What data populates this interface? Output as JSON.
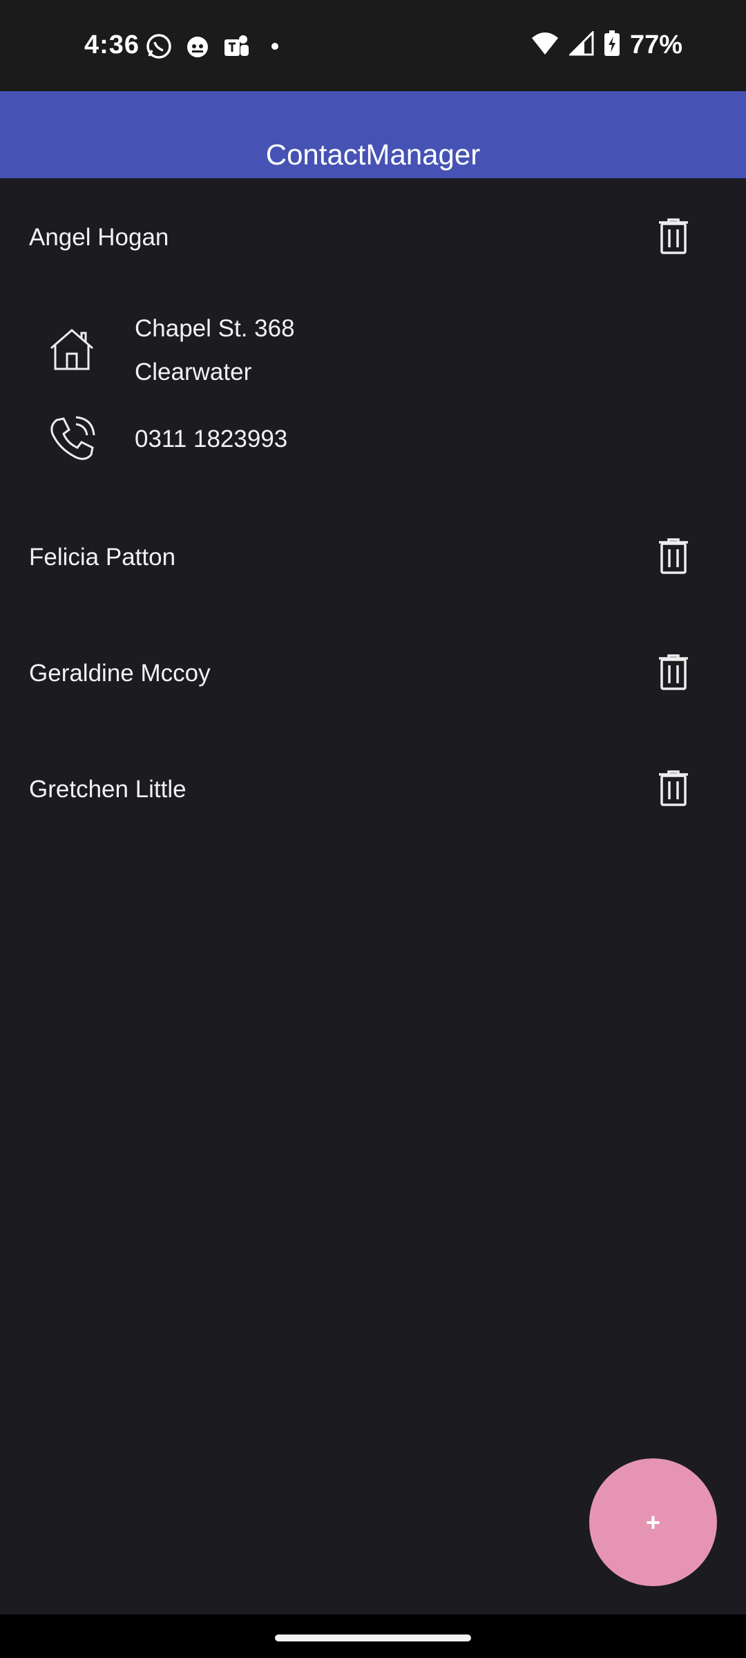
{
  "status_bar": {
    "time": "4:36",
    "battery": "77%",
    "left_icons": [
      "whatsapp-icon",
      "cat-face-icon",
      "teams-icon",
      "dot-icon"
    ],
    "right_icons": [
      "wifi-icon",
      "signal-icon",
      "battery-charging-icon"
    ]
  },
  "app_bar": {
    "title": "ContactManager",
    "color": "#4653b4"
  },
  "contacts": [
    {
      "name": "Angel Hogan",
      "expanded": true,
      "address_line1": "Chapel St. 368",
      "address_line2": "Clearwater",
      "phone": "0311 1823993"
    },
    {
      "name": "Felicia Patton",
      "expanded": false
    },
    {
      "name": "Geraldine Mccoy",
      "expanded": false
    },
    {
      "name": "Gretchen Little",
      "expanded": false
    }
  ],
  "fab": {
    "label": "+",
    "color": "#e595b2"
  },
  "colors": {
    "background": "#1c1b20",
    "status_bar": "#1b1b1b"
  }
}
